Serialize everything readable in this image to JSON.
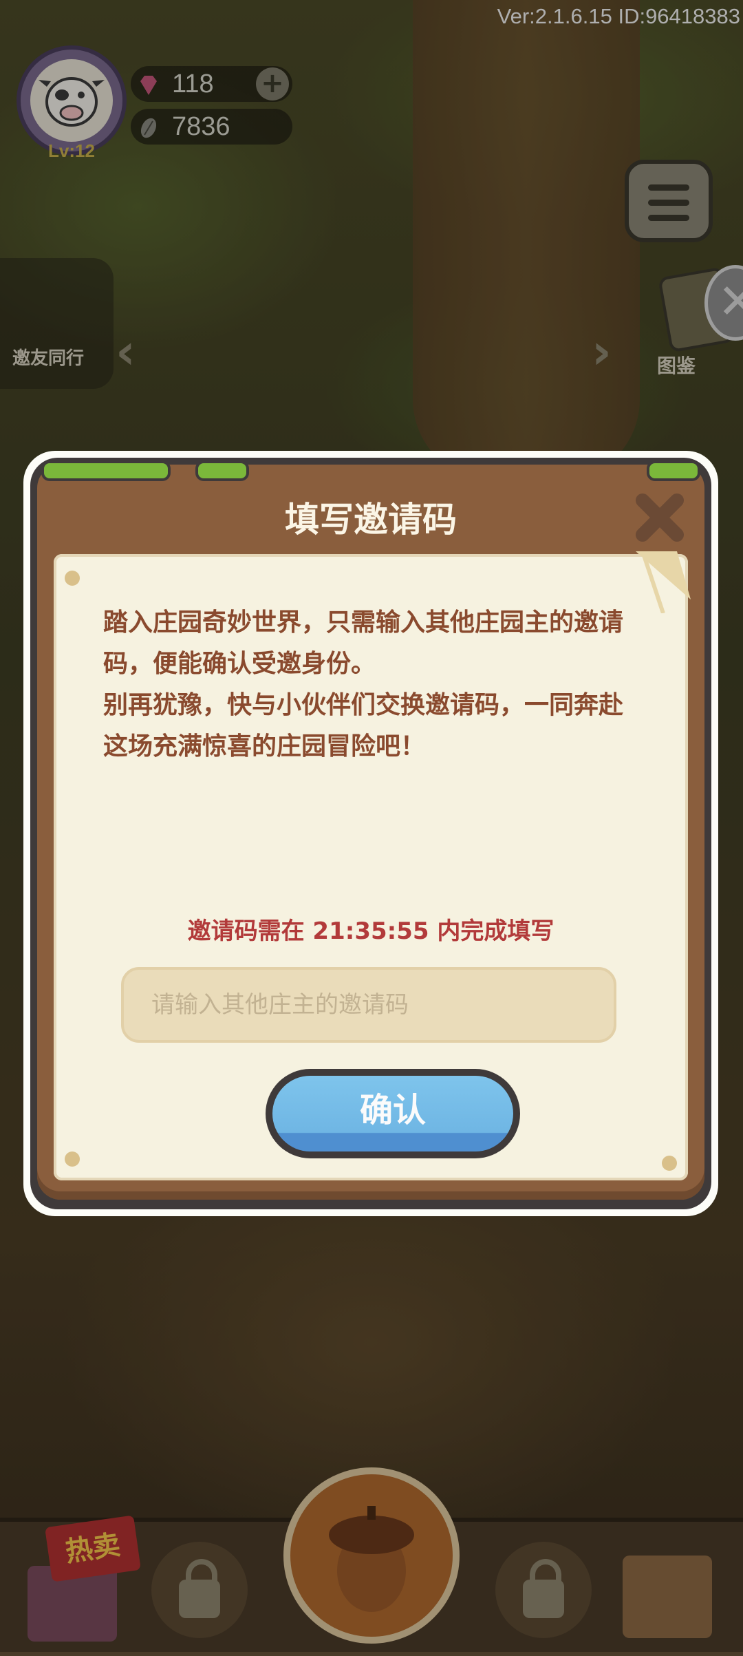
{
  "header": {
    "version_text": "Ver:2.1.6.15 ID:96418383",
    "level": "Lv:12",
    "gems": "118",
    "seeds": "7836"
  },
  "side": {
    "invite_label": "邀友同行",
    "tujian_label": "图鉴"
  },
  "dialog": {
    "title": "填写邀请码",
    "description": [
      "踏入庄园奇妙世界，只需输入其他庄园主的邀请码，便能确认受邀身份。",
      "别再犹豫，快与小伙伴们交换邀请码，一同奔赴这场充满惊喜的庄园冒险吧！"
    ],
    "timer_text": "邀请码需在 21:35:55 内完成填写",
    "input_placeholder": "请输入其他庄主的邀请码",
    "input_value": "",
    "confirm_label": "确认"
  },
  "bottom": {
    "hot_label": "热卖"
  },
  "colors": {
    "wood": "#8a5e3d",
    "paper": "#f6f2e0",
    "text_brown": "#8a4a2e",
    "timer_red": "#b23a3a",
    "confirm_blue": "#6fb6e4"
  }
}
